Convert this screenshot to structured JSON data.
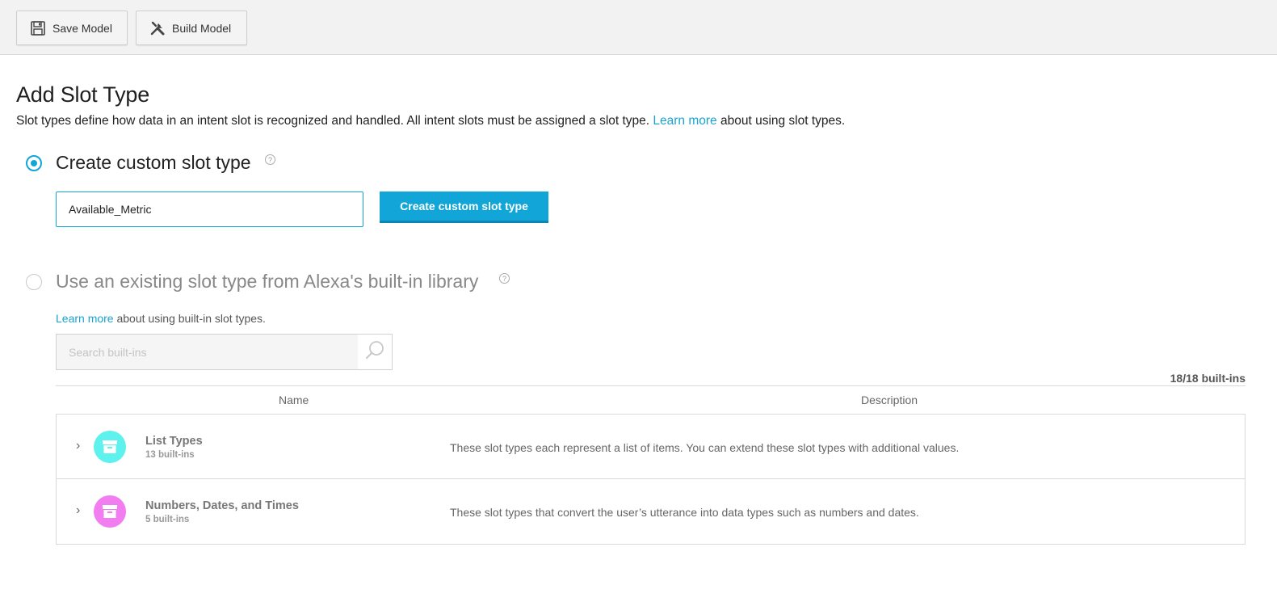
{
  "toolbar": {
    "save_label": "Save Model",
    "save_icon": "floppy-disk-icon",
    "build_label": "Build Model",
    "build_icon": "wrench-screwdriver-icon"
  },
  "page": {
    "title": "Add Slot Type",
    "description_before": "Slot types define how data in an intent slot is recognized and handled. All intent slots must be assigned a slot type. ",
    "description_link": "Learn more",
    "description_after": " about using slot types."
  },
  "custom_option": {
    "label": "Create custom slot type",
    "selected": true,
    "help_icon": "question-mark-icon",
    "input_value": "Available_Metric",
    "button_label": "Create custom slot type"
  },
  "builtin_option": {
    "label": "Use an existing slot type from Alexa's built-in library",
    "selected": false,
    "help_icon": "question-mark-icon",
    "note_link": "Learn more",
    "note_after": " about using built-in slot types.",
    "search_placeholder": "Search built-ins",
    "search_icon": "magnifier-icon",
    "count": "18/18 built-ins",
    "columns": {
      "name": "Name",
      "description": "Description"
    },
    "rows": [
      {
        "name": "List Types",
        "count": "13 built-ins",
        "description": "These slot types each represent a list of items. You can extend these slot types with additional values.",
        "icon": "archive-box-icon",
        "icon_color": "#5ef2ee"
      },
      {
        "name": "Numbers, Dates, and Times",
        "count": "5 built-ins",
        "description": "These slot types that convert the user’s utterance into data types such as numbers and dates.",
        "icon": "archive-box-icon",
        "icon_color": "#f27df0"
      }
    ]
  },
  "colors": {
    "accent": "#11a6d7",
    "link": "#1aa3cf",
    "toolbar_bg": "#f2f2f2"
  }
}
